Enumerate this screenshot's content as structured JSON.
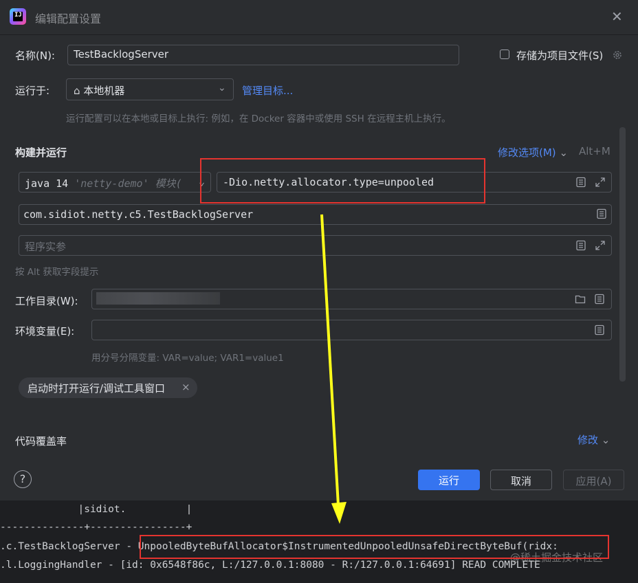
{
  "window": {
    "title": "编辑配置设置"
  },
  "name_row": {
    "label": "名称(N):",
    "value": "TestBacklogServer",
    "store_label": "存储为项目文件(S)"
  },
  "run_on": {
    "label": "运行于:",
    "target": "本地机器",
    "manage": "管理目标...",
    "hint": "运行配置可以在本地或目标上执行: 例如，在 Docker 容器中或使用 SSH 在远程主机上执行。"
  },
  "build_run": {
    "title": "构建并运行",
    "modify_options": "修改选项(M)",
    "shortcut": "Alt+M",
    "jdk": "java 14",
    "module": "'netty-demo' 模块(",
    "vm_options": "-Dio.netty.allocator.type=unpooled",
    "main_class": "com.sidiot.netty.c5.TestBacklogServer",
    "program_args_placeholder": "程序实参",
    "alt_hint": "按 Alt 获取字段提示"
  },
  "workdir": {
    "label": "工作目录(W):"
  },
  "env": {
    "label": "环境变量(E):",
    "hint": "用分号分隔变量: VAR=value; VAR1=value1"
  },
  "chip": {
    "label": "启动时打开运行/调试工具窗口",
    "close": "×"
  },
  "coverage": {
    "label": "代码覆盖率",
    "modify": "修改"
  },
  "footer": {
    "help": "?",
    "run": "运行",
    "cancel": "取消",
    "apply": "应用(A)"
  },
  "console": {
    "lines": [
      "             |sidiot.          |",
      "--------------+----------------+",
      ".c.TestBacklogServer - UnpooledByteBufAllocator$InstrumentedUnpooledUnsafeDirectByteBuf(ridx:",
      ".l.LoggingHandler - [id: 0x6548f86c, L:/127.0.0.1:8080 - R:/127.0.0.1:64691] READ COMPLETE"
    ],
    "watermark": "@稀土掘金技术社区"
  }
}
